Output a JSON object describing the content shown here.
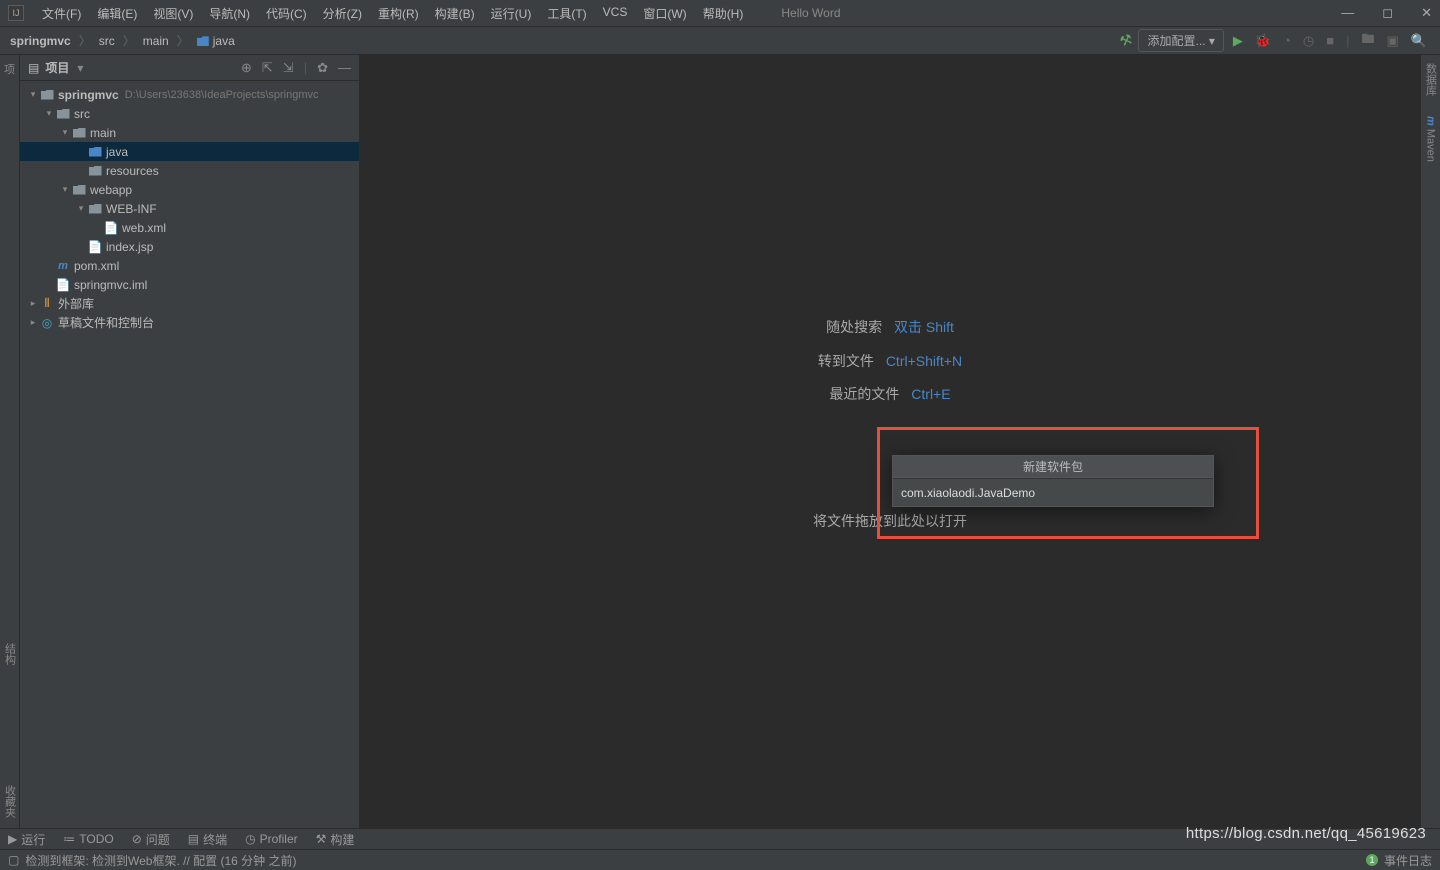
{
  "titlebar": {
    "menus": [
      "文件(F)",
      "编辑(E)",
      "视图(V)",
      "导航(N)",
      "代码(C)",
      "分析(Z)",
      "重构(R)",
      "构建(B)",
      "运行(U)",
      "工具(T)",
      "VCS",
      "窗口(W)",
      "帮助(H)"
    ],
    "app_title": "Hello Word"
  },
  "breadcrumb": {
    "items": [
      "springmvc",
      "src",
      "main",
      "java"
    ]
  },
  "navbar": {
    "config_label": "添加配置..."
  },
  "sidebar": {
    "title": "项目",
    "project_name": "springmvc",
    "project_path": "D:\\Users\\23638\\IdeaProjects\\springmvc",
    "nodes": {
      "src": "src",
      "main": "main",
      "java": "java",
      "resources": "resources",
      "webapp": "webapp",
      "webinf": "WEB-INF",
      "webxml": "web.xml",
      "indexjsp": "index.jsp",
      "pom": "pom.xml",
      "iml": "springmvc.iml",
      "ext": "外部库",
      "draft": "草稿文件和控制台"
    }
  },
  "editor_hints": {
    "search_lbl": "随处搜索",
    "search_key": "双击 Shift",
    "goto_lbl": "转到文件",
    "goto_key": "Ctrl+Shift+N",
    "recent_lbl": "最近的文件",
    "recent_key": "Ctrl+E",
    "drop_hint": "将文件拖放到此处以打开"
  },
  "popup": {
    "title": "新建软件包",
    "input_value": "com.xiaolaodi.JavaDemo"
  },
  "left_gutter": {
    "structure": "结构",
    "favorites": "收藏夹"
  },
  "right_gutter": {
    "database": "数据库",
    "maven": "Maven"
  },
  "bottombar": {
    "run": "运行",
    "todo": "TODO",
    "problems": "问题",
    "terminal": "终端",
    "profiler": "Profiler",
    "build": "构建"
  },
  "statusbar": {
    "message": "检测到框架: 检测到Web框架. // 配置 (16 分钟 之前)",
    "events": "事件日志",
    "badge": "1"
  },
  "watermark": "https://blog.csdn.net/qq_45619623"
}
